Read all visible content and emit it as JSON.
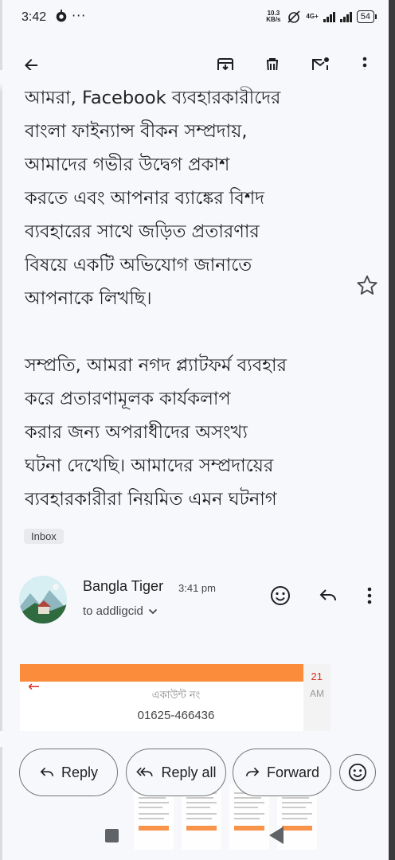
{
  "status_bar": {
    "time": "3:42",
    "dots": "···",
    "speed": "10.3 KB/s",
    "network": "4G+",
    "battery": "54"
  },
  "toolbar": {
    "back_icon": "arrow-back-icon",
    "archive_icon": "archive-icon",
    "delete_icon": "delete-icon",
    "mark_unread_icon": "mark-unread-icon",
    "more_icon": "more-vert-icon"
  },
  "message": {
    "clipped_line": "আমরা, Facebook ব্যবহারকারীদের",
    "paragraph1": [
      "বাংলা ফাইন্যান্স বীকন সম্প্রদায়,",
      "আমাদের গভীর উদ্বেগ প্রকাশ",
      "করতে এবং আপনার ব্যাঙ্কের বিশদ",
      "ব্যবহারের সাথে জড়িত প্রতারণার",
      "বিষয়ে একটি অভিযোগ জানাতে",
      "আপনাকে লিখছি।"
    ],
    "paragraph2": [
      "সম্প্রতি, আমরা নগদ প্ল্যাটফর্ম ব্যবহার",
      "করে প্রতারণামূলক কার্যকলাপ",
      "করার জন্য অপরাধীদের অসংখ্য",
      "ঘটনা দেখেছি। আমাদের সম্প্রদায়ের",
      "ব্যবহারকারীরা নিয়মিত এমন ঘটনাগ"
    ],
    "label": "Inbox"
  },
  "sender": {
    "name": "Bangla Tiger",
    "time": "3:41 pm",
    "to": "to addligcid"
  },
  "attachment": {
    "account_label": "একাউন্ট নং",
    "account_number": "01625-466436",
    "side_top": "21",
    "side_mid": "AM"
  },
  "actions": {
    "reply": "Reply",
    "reply_all": "Reply all",
    "forward": "Forward"
  },
  "colors": {
    "background": "#f6f8fc",
    "attachment_accent": "#fb8c3c",
    "text": "#1f1f1f"
  }
}
